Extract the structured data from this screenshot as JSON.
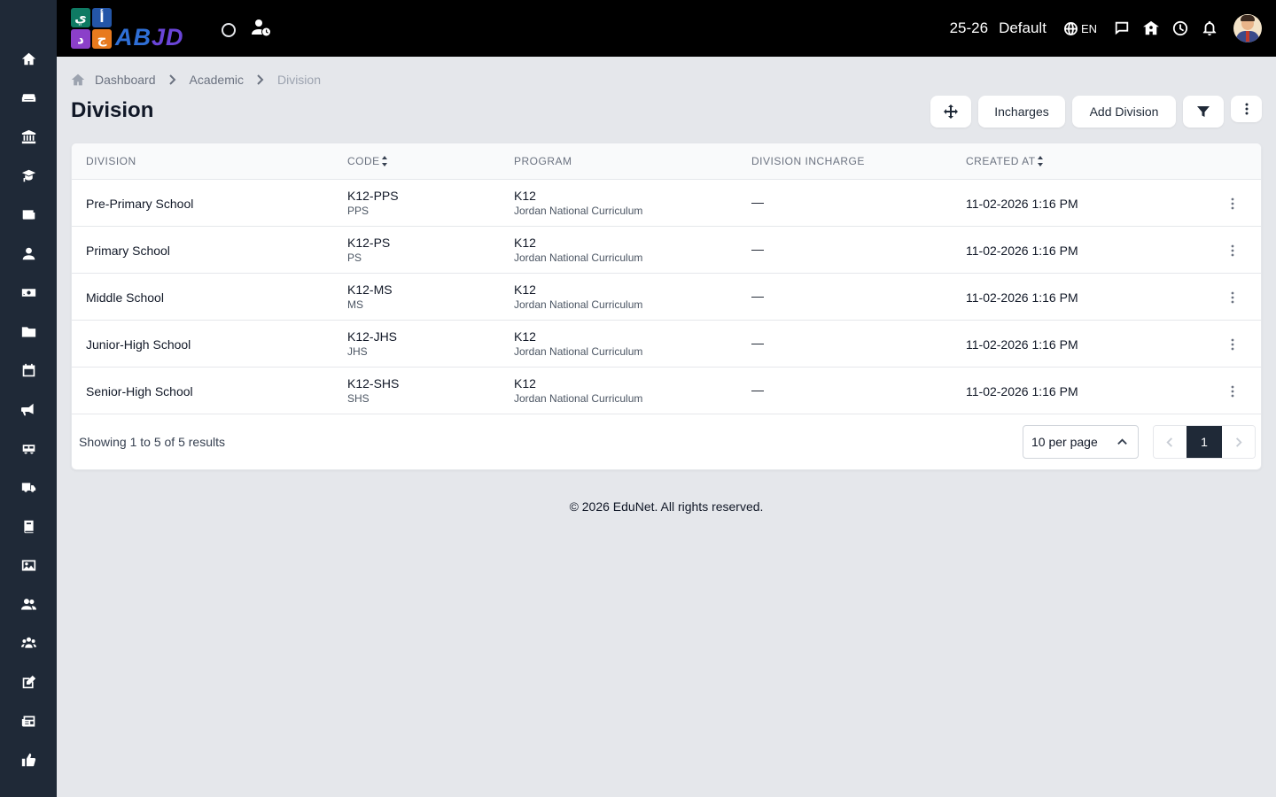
{
  "sidebar": {
    "icons": [
      "home-icon",
      "sofa-icon",
      "bank-icon",
      "graduate-icon",
      "news-icon",
      "user-tie-icon",
      "money-icon",
      "folder-icon",
      "calendar-icon",
      "megaphone-icon",
      "school-bus-icon",
      "truck-icon",
      "book-icon",
      "image-icon",
      "users-icon",
      "group-icon",
      "edit-icon",
      "newspaper-icon",
      "thumbs-up-icon"
    ]
  },
  "topbar": {
    "logo_tiles": [
      "ي",
      "أ",
      "د",
      "ج"
    ],
    "logo_word_a": "AB",
    "logo_word_b": "JD",
    "academic_year": "25-26",
    "branch": "Default",
    "language": "EN"
  },
  "breadcrumb": {
    "items": [
      "Dashboard",
      "Academic"
    ],
    "current": "Division"
  },
  "page": {
    "title": "Division"
  },
  "actions": {
    "incharges_label": "Incharges",
    "add_label": "Add Division"
  },
  "table": {
    "headers": {
      "division": "DIVISION",
      "code": "CODE",
      "program": "PROGRAM",
      "incharge": "DIVISION INCHARGE",
      "created": "CREATED AT"
    },
    "rows": [
      {
        "division": "Pre-Primary School",
        "code": "K12-PPS",
        "code_sub": "PPS",
        "program": "K12",
        "program_sub": "Jordan National Curriculum",
        "incharge": "—",
        "created": "11-02-2026 1:16 PM"
      },
      {
        "division": "Primary School",
        "code": "K12-PS",
        "code_sub": "PS",
        "program": "K12",
        "program_sub": "Jordan National Curriculum",
        "incharge": "—",
        "created": "11-02-2026 1:16 PM"
      },
      {
        "division": "Middle School",
        "code": "K12-MS",
        "code_sub": "MS",
        "program": "K12",
        "program_sub": "Jordan National Curriculum",
        "incharge": "—",
        "created": "11-02-2026 1:16 PM"
      },
      {
        "division": "Junior-High School",
        "code": "K12-JHS",
        "code_sub": "JHS",
        "program": "K12",
        "program_sub": "Jordan National Curriculum",
        "incharge": "—",
        "created": "11-02-2026 1:16 PM"
      },
      {
        "division": "Senior-High School",
        "code": "K12-SHS",
        "code_sub": "SHS",
        "program": "K12",
        "program_sub": "Jordan National Curriculum",
        "incharge": "—",
        "created": "11-02-2026 1:16 PM"
      }
    ]
  },
  "pagination": {
    "showing": "Showing 1 to 5 of 5 results",
    "per_page": "10 per page",
    "current_page": "1"
  },
  "footer": {
    "text": "© 2026 EduNet. All rights reserved."
  }
}
